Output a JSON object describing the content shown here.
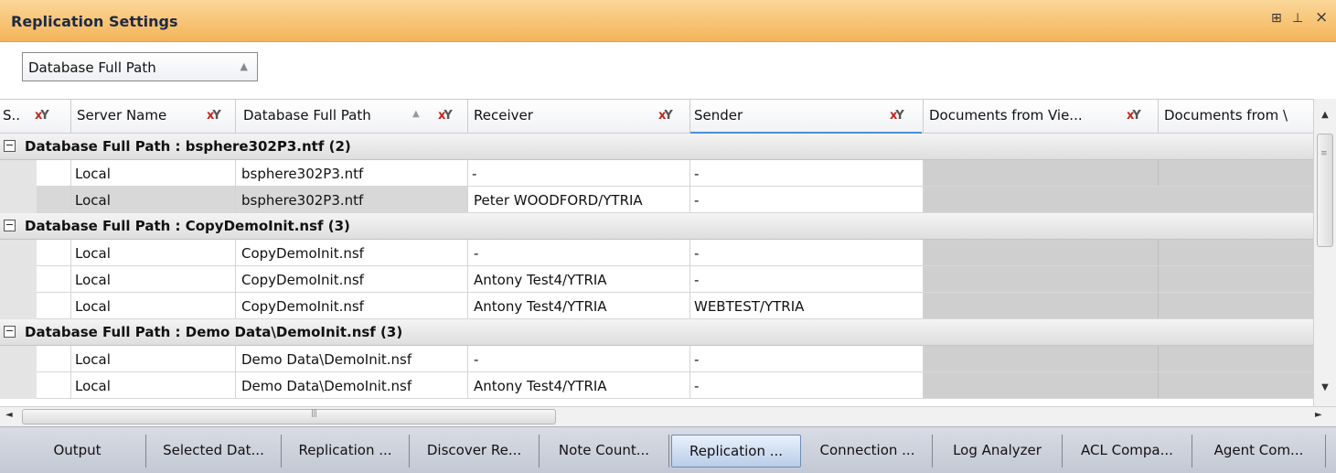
{
  "title": "Replication Settings",
  "window_controls": {
    "dock": "⊞",
    "pin": "⊥",
    "close": "×"
  },
  "group_by": {
    "label": "Database Full Path",
    "sort": "▲"
  },
  "columns": [
    {
      "label": "S..",
      "filter": true
    },
    {
      "label": "Server Name",
      "filter": true
    },
    {
      "label": "Database Full Path",
      "filter": true,
      "sorted": "asc"
    },
    {
      "label": "Receiver",
      "filter": true
    },
    {
      "label": "Sender",
      "filter": true
    },
    {
      "label": "Documents from Vie...",
      "filter": true
    },
    {
      "label": "Documents from \\",
      "filter": false
    }
  ],
  "groups": [
    {
      "label": "Database Full Path : bsphere302P3.ntf (2)",
      "rows": [
        {
          "server": "Local",
          "path": "bsphere302P3.ntf",
          "receiver": "-",
          "sender": "-"
        },
        {
          "server": "Local",
          "path": "bsphere302P3.ntf",
          "receiver": "Peter WOODFORD/YTRIA",
          "sender": "-"
        }
      ]
    },
    {
      "label": "Database Full Path : CopyDemoInit.nsf (3)",
      "rows": [
        {
          "server": "Local",
          "path": "CopyDemoInit.nsf",
          "receiver": "-",
          "sender": "-"
        },
        {
          "server": "Local",
          "path": "CopyDemoInit.nsf",
          "receiver": "Antony Test4/YTRIA",
          "sender": "-"
        },
        {
          "server": "Local",
          "path": "CopyDemoInit.nsf",
          "receiver": "Antony Test4/YTRIA",
          "sender": "WEBTEST/YTRIA"
        }
      ]
    },
    {
      "label": "Database Full Path : Demo Data\\DemoInit.nsf (3)",
      "rows": [
        {
          "server": "Local",
          "path": "Demo Data\\DemoInit.nsf",
          "receiver": "-",
          "sender": "-"
        },
        {
          "server": "Local",
          "path": "Demo Data\\DemoInit.nsf",
          "receiver": "Antony Test4/YTRIA",
          "sender": "-"
        }
      ]
    }
  ],
  "scrollbar": {
    "up": "▲",
    "down": "▼",
    "left": "◄",
    "right": "►"
  },
  "tabs": [
    {
      "label": "Output"
    },
    {
      "label": "Selected Dat..."
    },
    {
      "label": "Replication ..."
    },
    {
      "label": "Discover Re..."
    },
    {
      "label": "Note Count..."
    },
    {
      "label": "Replication ...",
      "active": true
    },
    {
      "label": "Connection ..."
    },
    {
      "label": "Log Analyzer"
    },
    {
      "label": "ACL Compa..."
    },
    {
      "label": "Agent Com..."
    }
  ]
}
